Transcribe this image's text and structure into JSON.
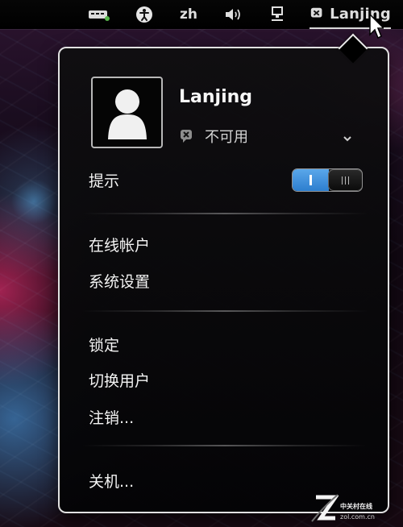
{
  "top_panel": {
    "language": "zh",
    "user_name": "Lanjing",
    "icons": {
      "keyboard": "keyboard-icon",
      "accessibility": "accessibility-icon",
      "volume": "volume-icon",
      "network": "network-icon",
      "unavailable_status": "status-unavailable-icon"
    }
  },
  "user_menu": {
    "name": "Lanjing",
    "status": "不可用",
    "avatar": "user-avatar-icon",
    "dropdown_icon": "chevron-down-icon",
    "notifications_label": "提示",
    "notifications_enabled": true,
    "online_accounts_label": "在线帐户",
    "system_settings_label": "系统设置",
    "lock_label": "锁定",
    "switch_user_label": "切换用户",
    "logout_label": "注销...",
    "power_off_label": "关机..."
  },
  "watermark": {
    "text": "中关村在线",
    "domain": "zol.com.cn",
    "logo": "zol-logo"
  },
  "colors": {
    "toggle_active": "#4b96df",
    "menu_border": "#e1e1e1",
    "panel_background": "#000000"
  }
}
